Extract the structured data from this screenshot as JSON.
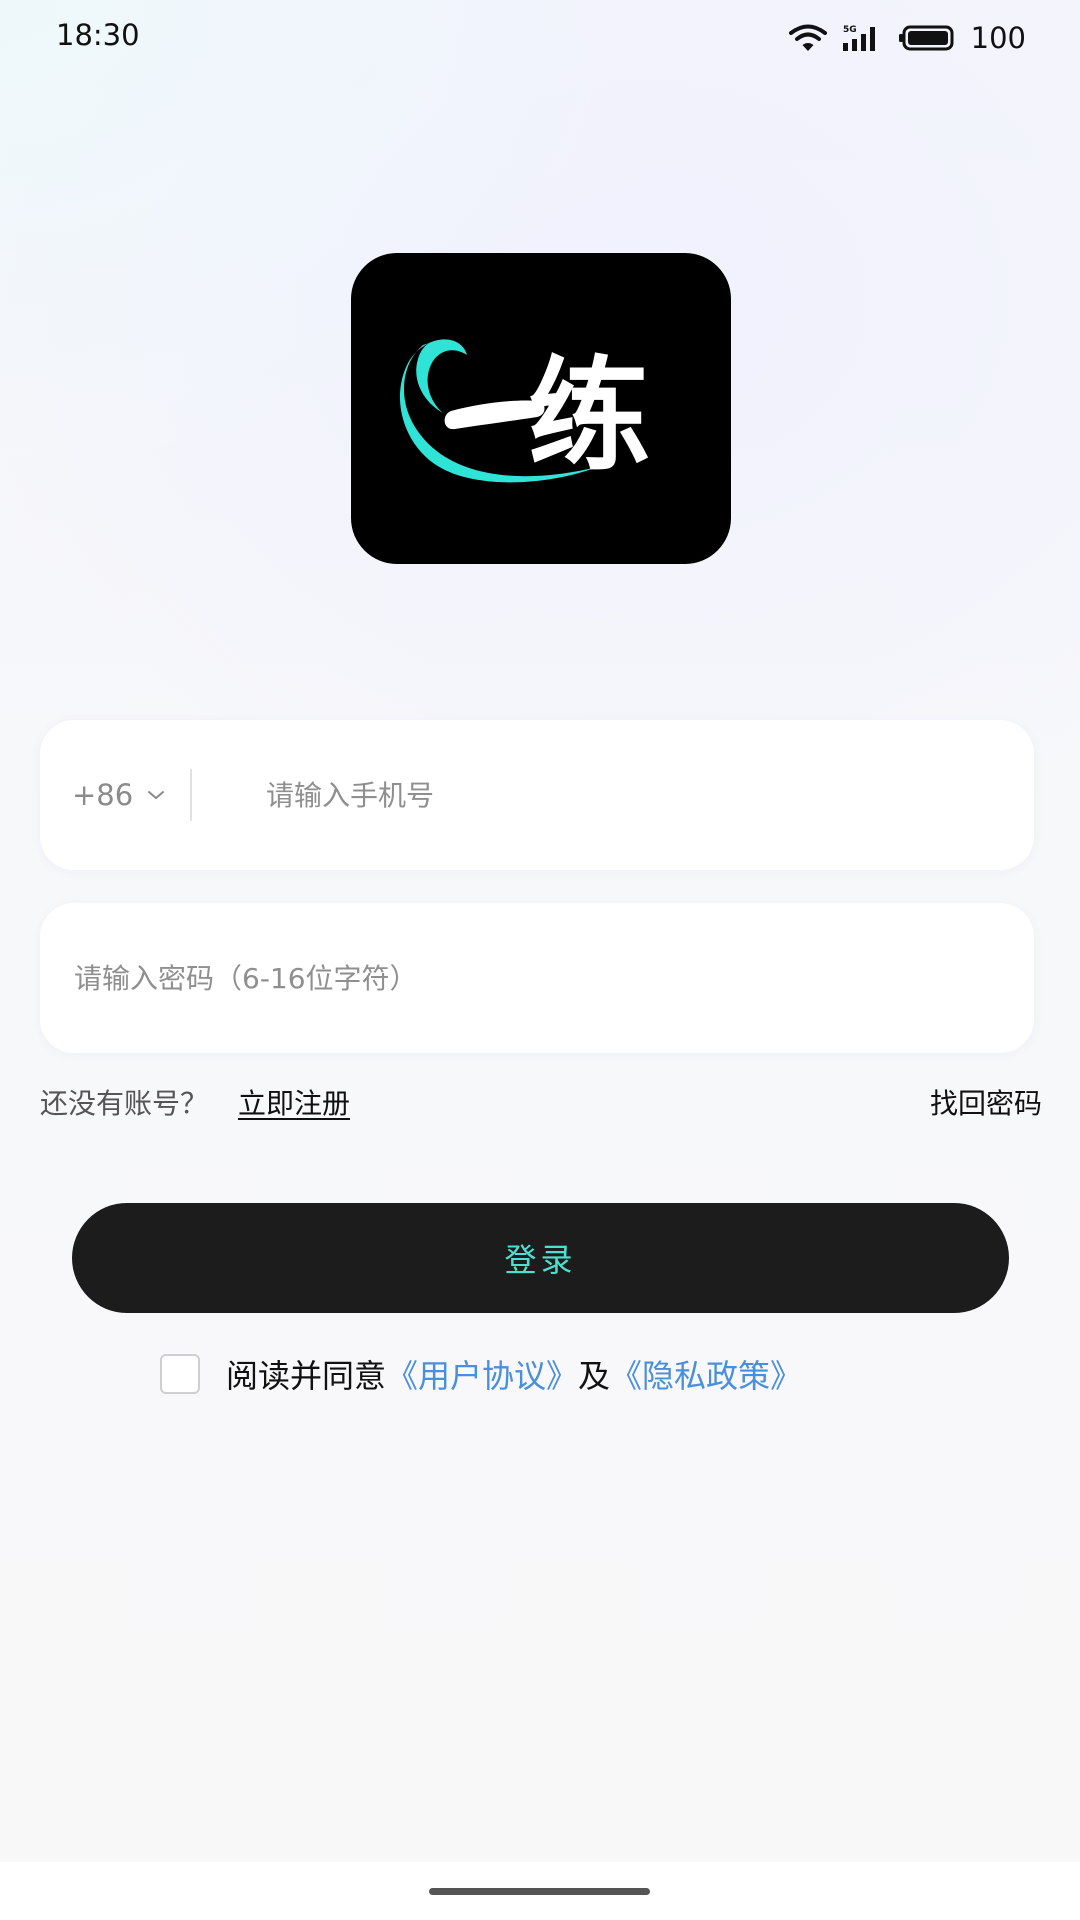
{
  "status_bar": {
    "time": "18:30",
    "network_label": "5G",
    "battery": "100"
  },
  "logo": {
    "app_name": "一练",
    "colors": {
      "background": "#000000",
      "swirl": "#2fe3d6",
      "text": "#ffffff"
    }
  },
  "phone_field": {
    "country_code": "+86",
    "placeholder": "请输入手机号"
  },
  "password_field": {
    "placeholder": "请输入密码（6-16位字符）"
  },
  "links": {
    "no_account": "还没有账号？",
    "register": "立即注册",
    "forgot_password": "找回密码"
  },
  "login_button": {
    "label": "登录",
    "colors": {
      "background": "#1c1c1c",
      "text": "#4de0d2"
    }
  },
  "agreement": {
    "prefix": "阅读并同意",
    "user_agreement": "《用户协议》",
    "conjunction": "及",
    "privacy_policy": "《隐私政策》",
    "checked": false,
    "link_color": "#4a8fdc"
  }
}
